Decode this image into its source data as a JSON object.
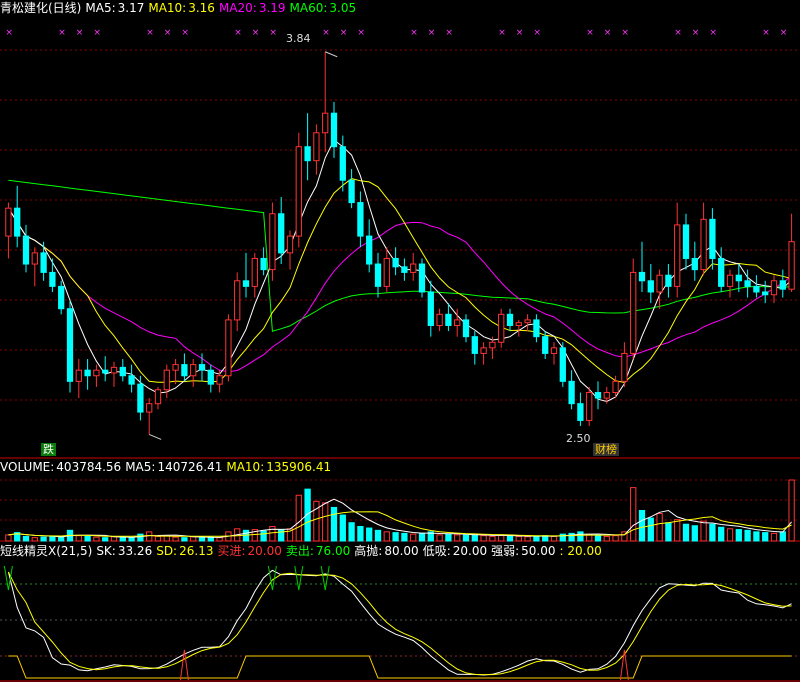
{
  "main": {
    "title": "青松建化(日线)",
    "ma5": {
      "label": "MA5:",
      "value": "3.17",
      "color": "#ffffff"
    },
    "ma10": {
      "label": "MA10:",
      "value": "3.16",
      "color": "#ffff00"
    },
    "ma20": {
      "label": "MA20:",
      "value": "3.19",
      "color": "#ff00ff"
    },
    "ma60": {
      "label": "MA60:",
      "value": "3.05",
      "color": "#00ff00"
    },
    "high_label": "3.84",
    "low_label": "2.50",
    "tag_left": "跌",
    "tag_right": "财榜"
  },
  "volume": {
    "name": "VOLUME:",
    "value": "403784.56",
    "ma5_label": "MA5:",
    "ma5_value": "140726.41",
    "ma10_label": "MA10:",
    "ma10_value": "135906.41"
  },
  "indicator": {
    "name": "短线精灵X(21,5)",
    "sk_label": "SK:",
    "sk_value": "33.26",
    "sd_label": "SD:",
    "sd_value": "26.13",
    "buy_label": "买进:",
    "buy_value": "20.00",
    "sell_label": "卖出:",
    "sell_value": "76.00",
    "high_label": "高抛:",
    "high_value": "80.00",
    "low_label": "低吸:",
    "low_value": "20.00",
    "strength_label": "强弱:",
    "strength_value": "50.00",
    "extra_value": ": 20.00"
  },
  "colors": {
    "up": "#ff3333",
    "down": "#00ffff",
    "ma5": "#ffffff",
    "ma10": "#ffff00",
    "ma20": "#ff00ff",
    "ma60": "#00ff00",
    "grid": "#8b0000",
    "sell": "#00cc00"
  },
  "chart_data": {
    "type": "candlestick",
    "price_range": [
      2.45,
      3.9
    ],
    "candles": [
      [
        3.18,
        3.3,
        3.1,
        3.28
      ],
      [
        3.28,
        3.36,
        3.14,
        3.18
      ],
      [
        3.18,
        3.22,
        3.05,
        3.08
      ],
      [
        3.08,
        3.14,
        3.0,
        3.12
      ],
      [
        3.12,
        3.16,
        3.02,
        3.05
      ],
      [
        3.05,
        3.1,
        2.98,
        3.0
      ],
      [
        3.0,
        3.02,
        2.9,
        2.92
      ],
      [
        2.92,
        2.95,
        2.62,
        2.66
      ],
      [
        2.66,
        2.74,
        2.6,
        2.7
      ],
      [
        2.7,
        2.74,
        2.63,
        2.68
      ],
      [
        2.68,
        2.72,
        2.64,
        2.7
      ],
      [
        2.7,
        2.75,
        2.66,
        2.69
      ],
      [
        2.69,
        2.73,
        2.64,
        2.71
      ],
      [
        2.71,
        2.74,
        2.66,
        2.68
      ],
      [
        2.68,
        2.72,
        2.62,
        2.65
      ],
      [
        2.65,
        2.68,
        2.52,
        2.55
      ],
      [
        2.55,
        2.6,
        2.47,
        2.58
      ],
      [
        2.58,
        2.64,
        2.56,
        2.63
      ],
      [
        2.63,
        2.72,
        2.6,
        2.7
      ],
      [
        2.7,
        2.74,
        2.65,
        2.72
      ],
      [
        2.72,
        2.76,
        2.66,
        2.68
      ],
      [
        2.68,
        2.74,
        2.64,
        2.72
      ],
      [
        2.72,
        2.76,
        2.66,
        2.7
      ],
      [
        2.7,
        2.72,
        2.62,
        2.65
      ],
      [
        2.65,
        2.7,
        2.62,
        2.68
      ],
      [
        2.68,
        2.9,
        2.66,
        2.88
      ],
      [
        2.88,
        3.05,
        2.84,
        3.02
      ],
      [
        3.02,
        3.12,
        2.96,
        3.0
      ],
      [
        3.0,
        3.12,
        2.96,
        3.1
      ],
      [
        3.1,
        3.14,
        3.04,
        3.06
      ],
      [
        3.06,
        3.3,
        3.02,
        3.26
      ],
      [
        3.26,
        3.32,
        3.08,
        3.12
      ],
      [
        3.12,
        3.2,
        3.06,
        3.18
      ],
      [
        3.18,
        3.55,
        3.14,
        3.5
      ],
      [
        3.5,
        3.62,
        3.38,
        3.45
      ],
      [
        3.45,
        3.58,
        3.4,
        3.55
      ],
      [
        3.55,
        3.84,
        3.48,
        3.62
      ],
      [
        3.62,
        3.66,
        3.46,
        3.5
      ],
      [
        3.5,
        3.54,
        3.34,
        3.38
      ],
      [
        3.38,
        3.42,
        3.28,
        3.3
      ],
      [
        3.3,
        3.34,
        3.14,
        3.18
      ],
      [
        3.18,
        3.24,
        3.05,
        3.08
      ],
      [
        3.08,
        3.12,
        2.96,
        3.0
      ],
      [
        3.0,
        3.14,
        2.98,
        3.1
      ],
      [
        3.1,
        3.14,
        3.04,
        3.07
      ],
      [
        3.07,
        3.1,
        3.02,
        3.05
      ],
      [
        3.05,
        3.12,
        3.02,
        3.08
      ],
      [
        3.08,
        3.1,
        2.96,
        2.98
      ],
      [
        2.98,
        3.02,
        2.82,
        2.86
      ],
      [
        2.86,
        2.92,
        2.84,
        2.9
      ],
      [
        2.9,
        2.94,
        2.84,
        2.86
      ],
      [
        2.86,
        2.92,
        2.82,
        2.88
      ],
      [
        2.88,
        2.9,
        2.8,
        2.82
      ],
      [
        2.82,
        2.84,
        2.72,
        2.76
      ],
      [
        2.76,
        2.8,
        2.72,
        2.78
      ],
      [
        2.78,
        2.82,
        2.74,
        2.8
      ],
      [
        2.8,
        2.92,
        2.78,
        2.9
      ],
      [
        2.9,
        2.92,
        2.84,
        2.86
      ],
      [
        2.86,
        2.88,
        2.82,
        2.87
      ],
      [
        2.87,
        2.9,
        2.84,
        2.88
      ],
      [
        2.88,
        2.9,
        2.8,
        2.82
      ],
      [
        2.82,
        2.84,
        2.74,
        2.76
      ],
      [
        2.76,
        2.8,
        2.72,
        2.78
      ],
      [
        2.78,
        2.8,
        2.64,
        2.66
      ],
      [
        2.66,
        2.7,
        2.56,
        2.58
      ],
      [
        2.58,
        2.62,
        2.5,
        2.52
      ],
      [
        2.52,
        2.64,
        2.5,
        2.62
      ],
      [
        2.62,
        2.66,
        2.56,
        2.6
      ],
      [
        2.6,
        2.64,
        2.58,
        2.62
      ],
      [
        2.62,
        2.68,
        2.6,
        2.66
      ],
      [
        2.66,
        2.8,
        2.64,
        2.76
      ],
      [
        2.76,
        3.1,
        2.74,
        3.05
      ],
      [
        3.05,
        3.16,
        2.98,
        3.02
      ],
      [
        3.02,
        3.08,
        2.94,
        2.98
      ],
      [
        2.98,
        3.06,
        2.92,
        3.04
      ],
      [
        3.04,
        3.08,
        2.96,
        3.0
      ],
      [
        3.0,
        3.3,
        2.96,
        3.22
      ],
      [
        3.22,
        3.26,
        3.06,
        3.1
      ],
      [
        3.1,
        3.16,
        3.02,
        3.06
      ],
      [
        3.06,
        3.3,
        3.04,
        3.24
      ],
      [
        3.24,
        3.28,
        3.06,
        3.1
      ],
      [
        3.1,
        3.14,
        2.98,
        3.0
      ],
      [
        3.0,
        3.06,
        2.96,
        3.04
      ],
      [
        3.04,
        3.08,
        2.98,
        3.02
      ],
      [
        3.02,
        3.06,
        2.96,
        3.0
      ],
      [
        3.0,
        3.04,
        2.96,
        2.98
      ],
      [
        2.98,
        3.02,
        2.94,
        2.97
      ],
      [
        2.97,
        3.04,
        2.94,
        3.02
      ],
      [
        3.02,
        3.06,
        2.96,
        2.99
      ],
      [
        2.99,
        3.26,
        2.98,
        3.16
      ]
    ],
    "volume_bars": [
      40,
      55,
      30,
      22,
      25,
      28,
      30,
      70,
      35,
      30,
      25,
      22,
      28,
      25,
      20,
      45,
      60,
      30,
      35,
      25,
      22,
      28,
      20,
      25,
      22,
      60,
      80,
      70,
      75,
      65,
      95,
      75,
      80,
      300,
      340,
      260,
      250,
      220,
      170,
      120,
      95,
      85,
      70,
      60,
      55,
      50,
      45,
      50,
      60,
      40,
      45,
      40,
      38,
      42,
      35,
      30,
      38,
      35,
      30,
      28,
      32,
      35,
      30,
      45,
      50,
      60,
      40,
      35,
      30,
      35,
      60,
      350,
      200,
      150,
      180,
      120,
      140,
      110,
      100,
      130,
      110,
      90,
      80,
      75,
      70,
      60,
      55,
      50,
      60,
      400
    ],
    "indicator_levels": {
      "high": 80,
      "low": 20,
      "mid": 50
    }
  }
}
